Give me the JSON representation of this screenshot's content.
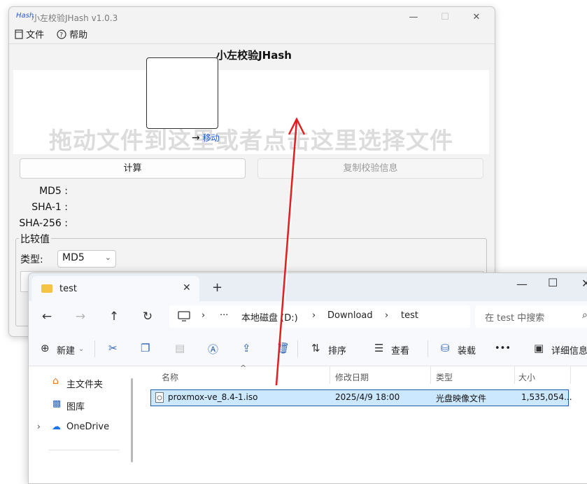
{
  "jhash": {
    "logo": "Hash",
    "title": "小左校验JHash v1.0.3",
    "window_controls": {
      "minimize": "—",
      "maximize": "☐",
      "close": "✕"
    },
    "menu": [
      {
        "icon": "file-icon",
        "label": "文件"
      },
      {
        "icon": "help-icon",
        "label": "帮助"
      }
    ],
    "heading": "小左校验JHash",
    "dropzone_hint": "拖动文件到这里或者点击这里选择文件",
    "buttons": {
      "compute": "计算",
      "copy": "复制校验信息"
    },
    "hashes": [
      {
        "label": "MD5 :",
        "value": ""
      },
      {
        "label": "SHA-1 :",
        "value": ""
      },
      {
        "label": "SHA-256 :",
        "value": ""
      }
    ],
    "compare": {
      "group_title": "比较值",
      "type_label": "类型:",
      "type_value": "MD5"
    }
  },
  "drag": {
    "action_label": "移动"
  },
  "explorer": {
    "tab_title": "test",
    "breadcrumb": [
      "本地磁盘 (D:)",
      "Download",
      "test"
    ],
    "search_placeholder": "在 test 中搜索",
    "toolbar": {
      "new": "新建",
      "sort": "排序",
      "view": "查看",
      "mount": "装载",
      "more": "•••",
      "details": "详细信息"
    },
    "sidebar": [
      {
        "icon": "home-icon",
        "label": "主文件夹"
      },
      {
        "icon": "gallery-icon",
        "label": "图库"
      },
      {
        "icon": "onedrive-icon",
        "label": "OneDrive"
      }
    ],
    "columns": [
      "名称",
      "修改日期",
      "类型",
      "大小"
    ],
    "files": [
      {
        "name": "proxmox-ve_8.4-1.iso",
        "modified": "2025/4/9 18:00",
        "type": "光盘映像文件",
        "size": "1,535,054..."
      }
    ]
  },
  "colors": {
    "accent": "#1a5fb4",
    "annotation_arrow": "#e02020",
    "selection": "#cce8ff"
  }
}
